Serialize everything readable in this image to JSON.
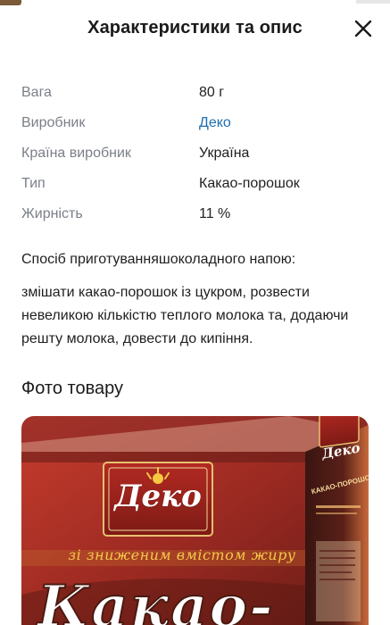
{
  "header": {
    "title": "Характеристики та опис",
    "close_icon": "close-icon"
  },
  "specs": [
    {
      "key": "Вага",
      "value": "80 г"
    },
    {
      "key": "Виробник",
      "value": "Деко",
      "link": true
    },
    {
      "key": "Країна виробник",
      "value": "Україна"
    },
    {
      "key": "Тип",
      "value": "Какао-порошок"
    },
    {
      "key": "Жирність",
      "value": "11 %"
    }
  ],
  "preparation": {
    "title": "Спосіб приготуванняшоколадного напою:",
    "text": "змішати какао-порошок із цукром, розвести невеликою кількістю теплого молока та, додаючи решту молока, довести до кипіння."
  },
  "photo_section": {
    "title": "Фото товару",
    "package": {
      "brand": "Деко",
      "subtitle": "зі зниженим вмістом жиру",
      "product_name": "Какао-",
      "side_label": "КАКАО-ПОРОШОК"
    }
  },
  "colors": {
    "link": "#1f6fb2",
    "label_gray": "#7a7f87",
    "package_red": "#a3322a",
    "package_brown": "#4a1a12"
  }
}
